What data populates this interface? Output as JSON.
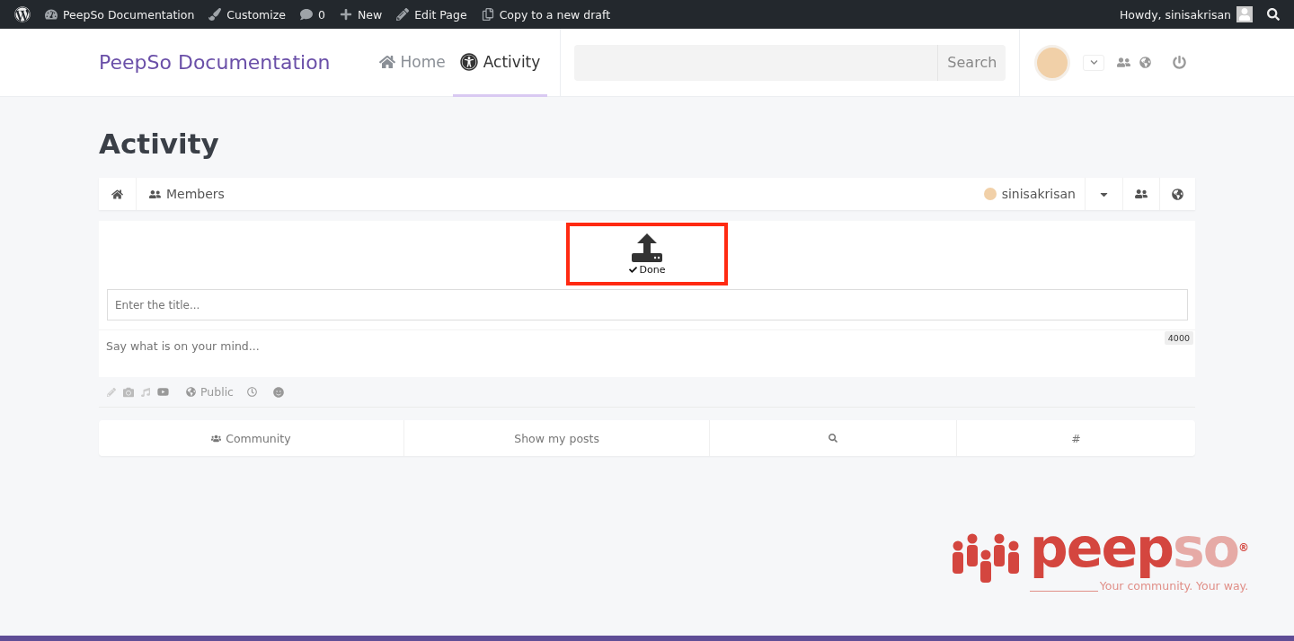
{
  "admin_bar": {
    "items": [
      {
        "label": "PeepSo Documentation"
      },
      {
        "label": "Customize"
      },
      {
        "label": "0"
      },
      {
        "label": "New"
      },
      {
        "label": "Edit Page"
      },
      {
        "label": "Copy to a new draft"
      }
    ],
    "greeting": "Howdy, sinisakrisan"
  },
  "header": {
    "site_title": "PeepSo Documentation",
    "nav": [
      {
        "label": "Home",
        "selected": false
      },
      {
        "label": "Activity",
        "selected": true
      }
    ],
    "search": {
      "button": "Search"
    }
  },
  "page_title": "Activity",
  "profile_nav": {
    "members": "Members",
    "user": "sinisakrisan"
  },
  "postbox": {
    "upload_status": "Done",
    "title_placeholder": "Enter the title...",
    "body_placeholder": "Say what is on your mind...",
    "counter": "4000",
    "privacy": "Public"
  },
  "filters": [
    {
      "kind": "community",
      "label": "Community"
    },
    {
      "kind": "text",
      "label": "Show my posts"
    },
    {
      "kind": "search"
    },
    {
      "kind": "text",
      "label": "#"
    }
  ],
  "logo": {
    "brand_main": "peep",
    "brand_accent": "so",
    "mark": "®",
    "tagline": "Your community. Your way."
  }
}
